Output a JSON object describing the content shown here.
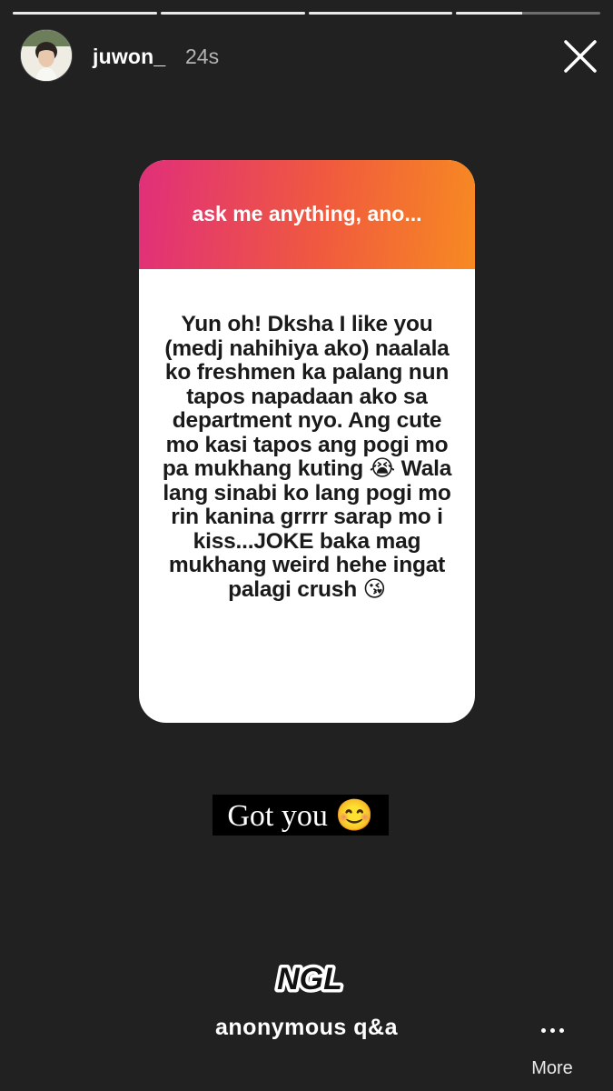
{
  "story": {
    "progress": [
      1.0,
      1.0,
      1.0,
      0.46
    ],
    "username": "juwon_",
    "time_ago": "24s"
  },
  "question_card": {
    "title": "ask me anything, ano...",
    "answer": "Yun oh! Dksha I like you (medj nahihiya ako) naalala ko freshmen ka palang nun tapos napadaan ako sa department nyo. Ang cute mo kasi tapos ang pogi mo pa mukhang kuting 😭 Wala lang sinabi ko lang pogi mo rin kanina grrrr sarap mo i kiss...JOKE baka mag mukhang weird hehe ingat palagi crush 😘",
    "gradient": [
      "#e02f7a",
      "#f78a22"
    ]
  },
  "caption": {
    "text": "Got you 😊"
  },
  "footer": {
    "logo_text": "NGL",
    "label": "anonymous q&a",
    "more_label": "More"
  },
  "icons": {
    "close": "close-icon",
    "more": "more-dots-icon"
  }
}
